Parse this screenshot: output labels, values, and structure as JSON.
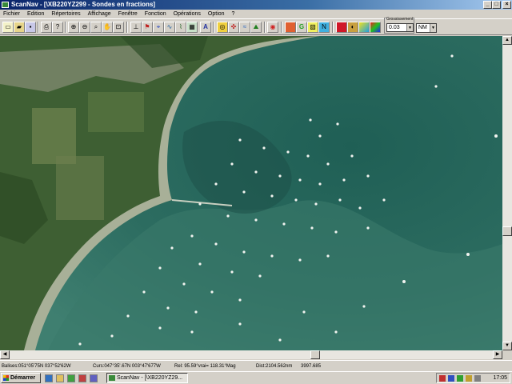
{
  "window": {
    "title": "ScanNav - [\\XB220YZ299 - Sondes en fractions]",
    "controls": [
      "_",
      "□",
      "×"
    ]
  },
  "menu": [
    "Fichier",
    "Edition",
    "Répertoires",
    "Affichage",
    "Fenêtre",
    "Fonction",
    "Opérations",
    "Option",
    "?"
  ],
  "toolbar": {
    "icons": [
      "new-icon",
      "open-icon",
      "save-icon",
      "print-icon",
      "info-icon",
      "zoom-in-icon",
      "zoom-out-icon",
      "zoom-window-icon",
      "pan-icon",
      "full-view-icon",
      "select-icon",
      "route-icon",
      "waypoint-icon",
      "track-icon",
      "depth-icon",
      "chart-icon",
      "text-icon",
      "gps-icon",
      "compass-icon",
      "tide-icon",
      "mob-icon",
      "layer-icon",
      "grid-icon",
      "palette-icon",
      "color-icon",
      "rgb-icon",
      "pencil-icon"
    ],
    "scale_caption": "Grossissement",
    "scale_value": "0.03",
    "unit_value": "NM"
  },
  "statusbar": {
    "balises": "Balises:051°05'75N 037°52'62W",
    "curseur": "Curs:047°35'.67N 003°47'677W",
    "relevement": "Rel: 95.59°vrai= 118.31°Mag",
    "distance": "Dist:2104.562nm",
    "extra": "3997.685"
  },
  "taskbar": {
    "start_label": "Démarrer",
    "task_label": "ScanNav - [\\XB220YZ29...",
    "clock": "17:05"
  }
}
